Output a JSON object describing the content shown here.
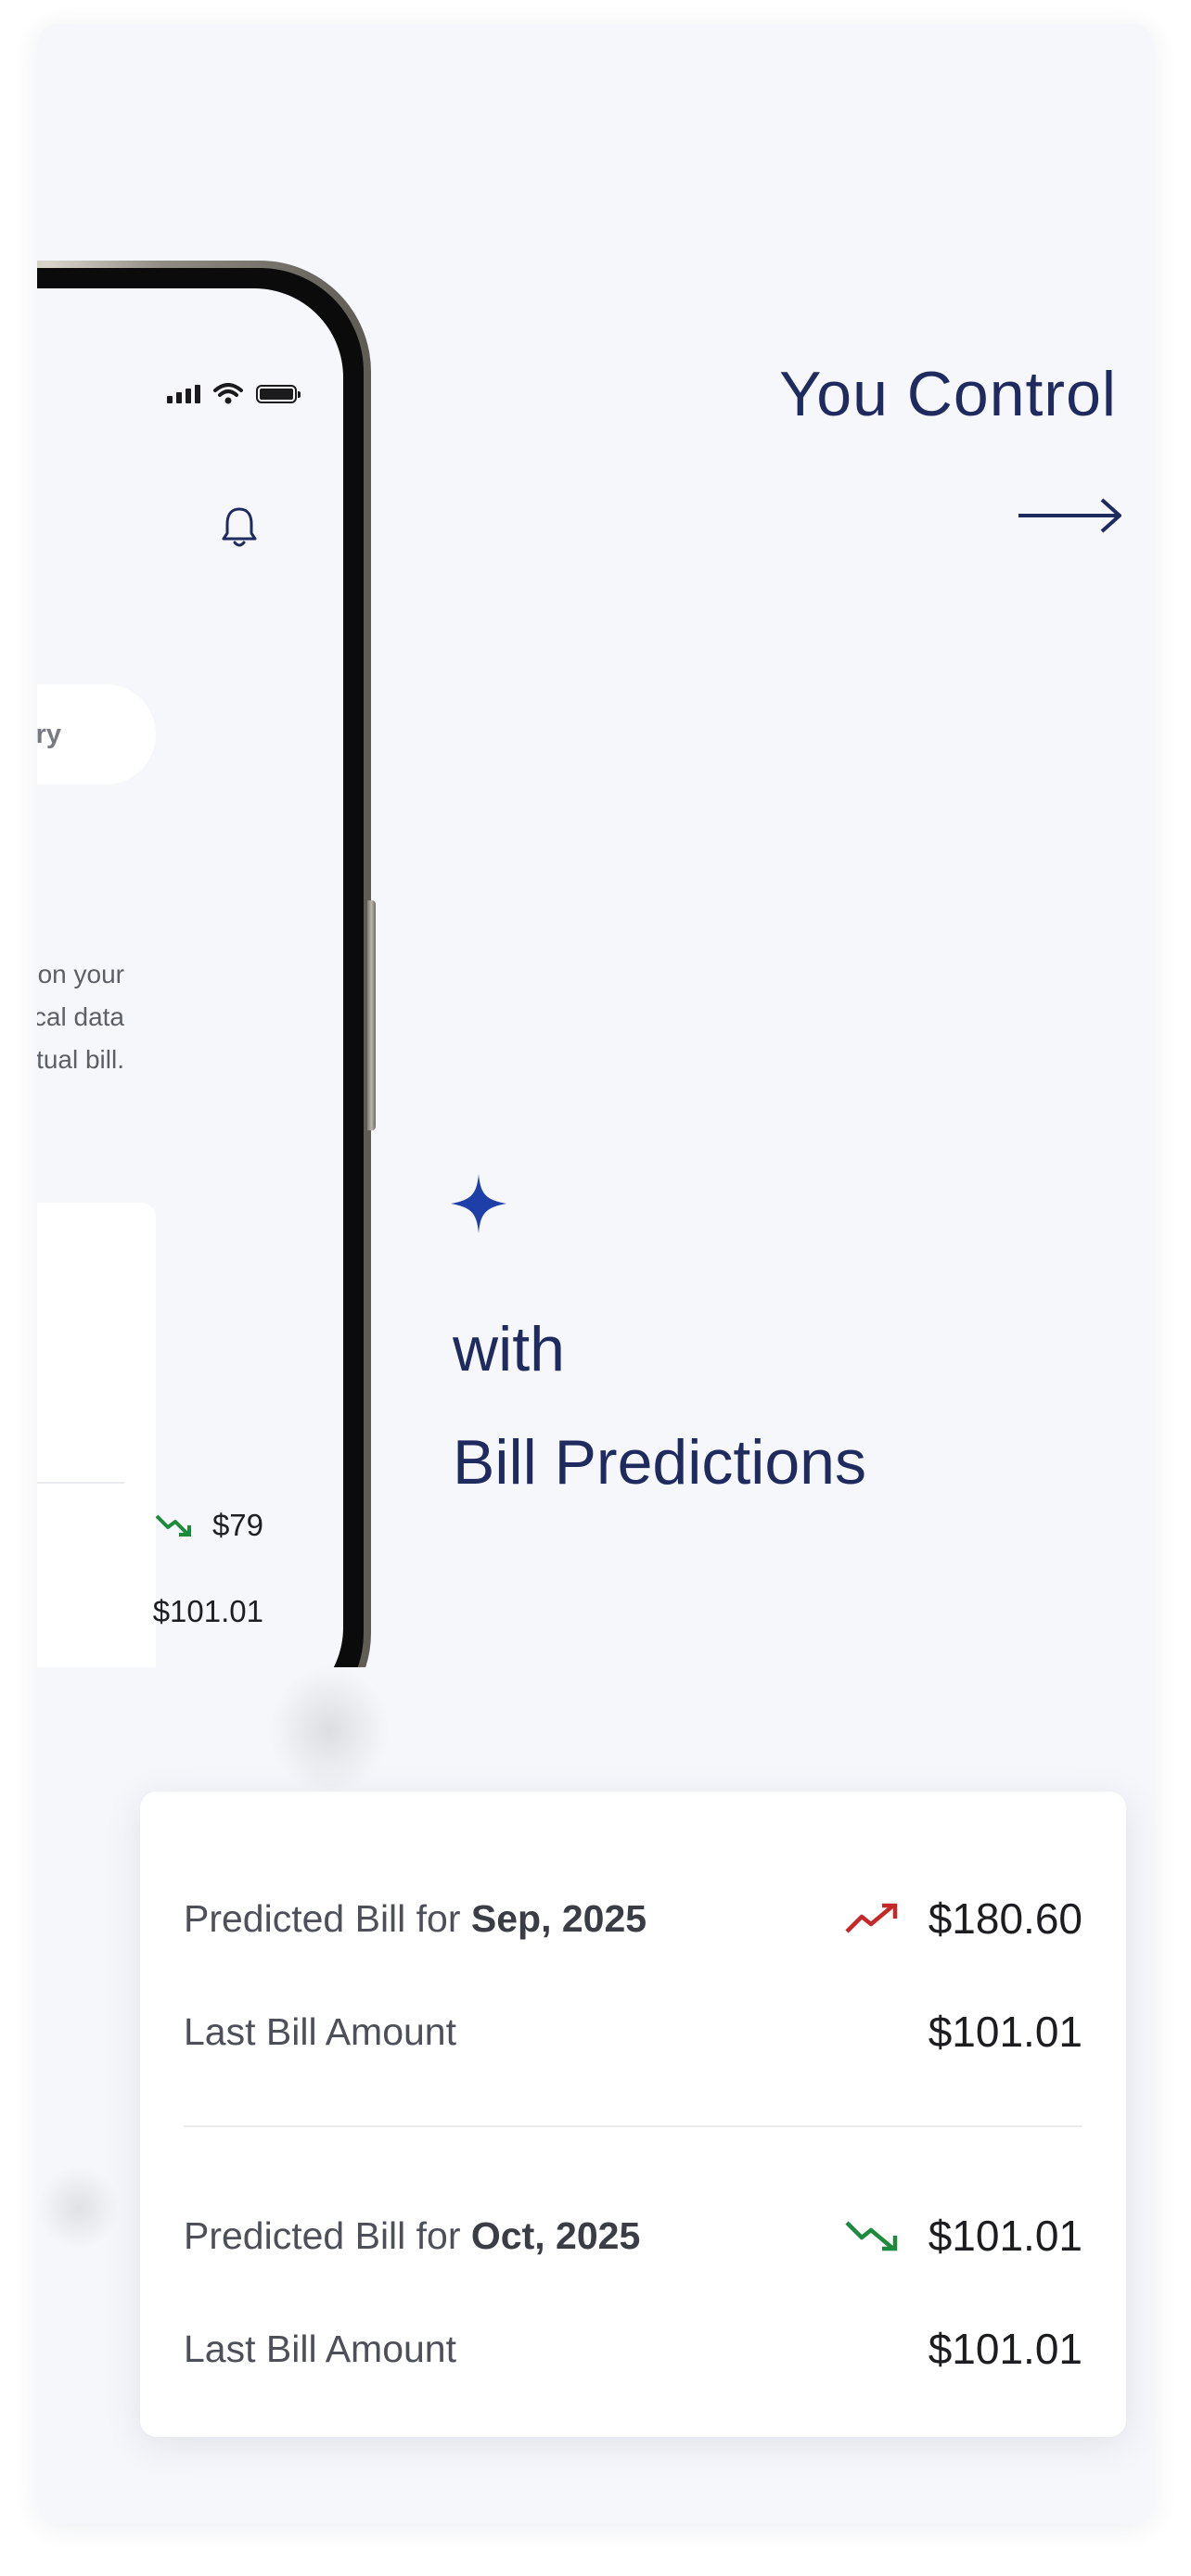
{
  "hero": {
    "line1": "You Control",
    "line2": "with",
    "line3": "Bill Predictions"
  },
  "phone": {
    "tab_label": "History",
    "description": "d on your\norical data\nctual bill.",
    "mini_value_1": "$79",
    "mini_value_2": "$101.01"
  },
  "bill_card": {
    "rows": [
      {
        "label_prefix": "Predicted Bill for ",
        "label_month": "Sep, 2025",
        "value": "$180.60",
        "trend": "up",
        "trend_icon": "trending-up-icon",
        "trend_color": "#c62828"
      },
      {
        "label": "Last Bill Amount",
        "value": "$101.01"
      },
      {
        "label_prefix": "Predicted Bill for ",
        "label_month": "Oct, 2025",
        "value": "$101.01",
        "trend": "down",
        "trend_icon": "trending-down-icon",
        "trend_color": "#1e8a3c"
      },
      {
        "label": "Last Bill Amount",
        "value": "$101.01"
      }
    ]
  },
  "colors": {
    "brand_navy": "#1f2b5e",
    "sparkle_blue": "#1e3fa8",
    "background": "#f6f7fb"
  }
}
